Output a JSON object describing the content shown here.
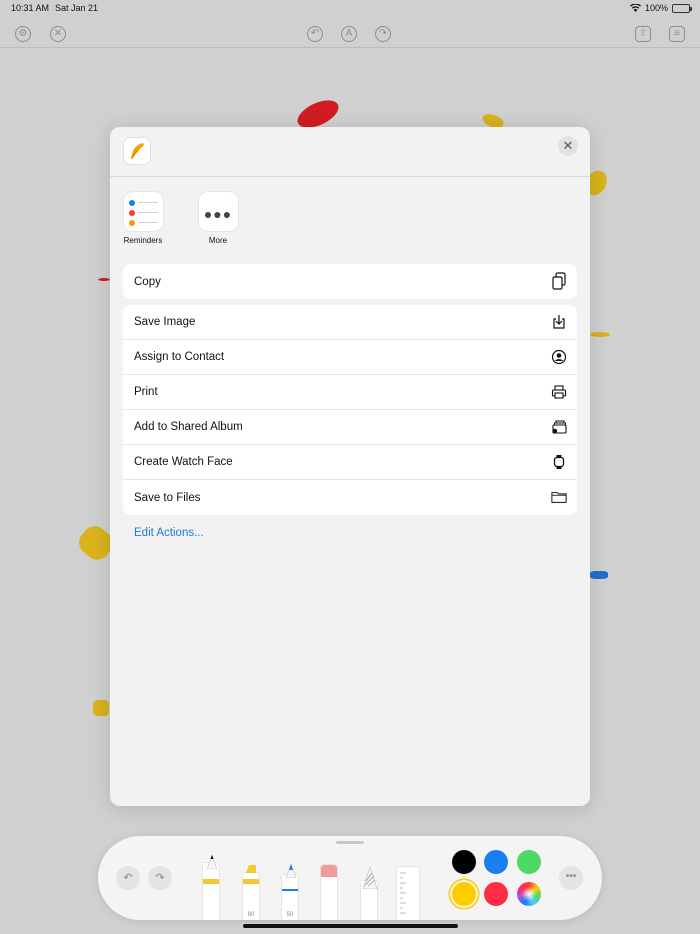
{
  "status": {
    "time": "10:31 AM",
    "date": "Sat Jan 21",
    "battery": "100%"
  },
  "sheet": {
    "apps": [
      {
        "label": "Reminders"
      },
      {
        "label": "More"
      }
    ],
    "copy_group": [
      {
        "label": "Copy",
        "icon": "copy-icon"
      }
    ],
    "actions": [
      {
        "label": "Save Image",
        "icon": "save-image-icon"
      },
      {
        "label": "Assign to Contact",
        "icon": "contact-icon"
      },
      {
        "label": "Print",
        "icon": "printer-icon"
      },
      {
        "label": "Add to Shared Album",
        "icon": "shared-album-icon"
      },
      {
        "label": "Create Watch Face",
        "icon": "watch-icon"
      },
      {
        "label": "Save to Files",
        "icon": "folder-icon"
      }
    ],
    "edit_actions": "Edit Actions..."
  },
  "toolbar": {
    "tool_labels": {
      "marker": "80",
      "pen": "50"
    },
    "colors": [
      "#000000",
      "#1a7ef2",
      "#4cd964",
      "#ffcc00",
      "#ff2d45"
    ]
  }
}
